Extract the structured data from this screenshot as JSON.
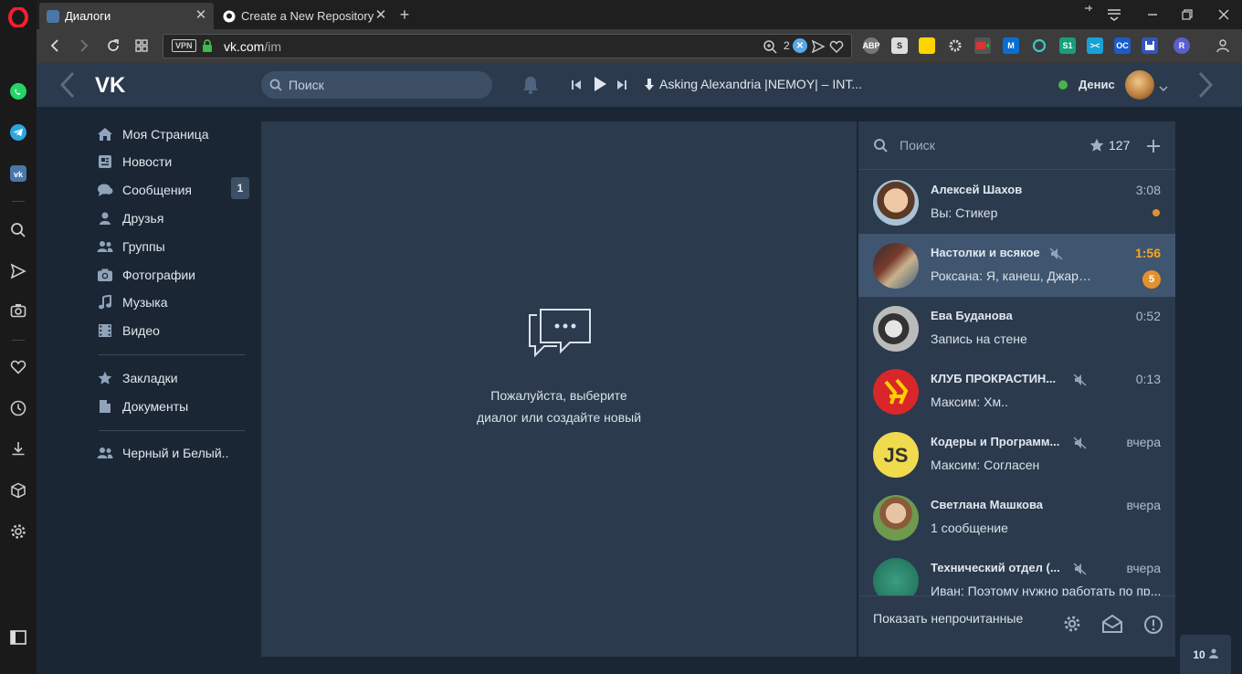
{
  "browser": {
    "tabs": [
      {
        "label": "Диалоги",
        "active": true
      },
      {
        "label": "Create a New Repository",
        "active": false
      }
    ],
    "url_host": "vk.com",
    "url_path": "/im",
    "vpn_label": "VPN",
    "zoom_badge": "2",
    "extensions": [
      "ABP",
      "S",
      "S1",
      "OC",
      "R"
    ]
  },
  "vk": {
    "search_placeholder": "Поиск",
    "now_playing": "Asking Alexandria |NEMOY| – INT...",
    "user_name": "Денис",
    "menu": [
      {
        "label": "Моя Страница",
        "icon": "home-icon"
      },
      {
        "label": "Новости",
        "icon": "news-icon"
      },
      {
        "label": "Сообщения",
        "icon": "messages-icon",
        "badge": "1"
      },
      {
        "label": "Друзья",
        "icon": "friend-icon"
      },
      {
        "label": "Группы",
        "icon": "groups-icon"
      },
      {
        "label": "Фотографии",
        "icon": "camera-icon"
      },
      {
        "label": "Музыка",
        "icon": "music-icon"
      },
      {
        "label": "Видео",
        "icon": "video-icon"
      },
      {
        "label": "Закладки",
        "icon": "star-icon"
      },
      {
        "label": "Документы",
        "icon": "document-icon"
      },
      {
        "label": "Черный и Белый..",
        "icon": "groups-icon"
      }
    ],
    "empty_line1": "Пожалуйста, выберите",
    "empty_line2": "диалог или создайте новый",
    "dialogs_search_placeholder": "Поиск",
    "favorites_count": "127",
    "conversations": [
      {
        "name": "Алексей Шахов",
        "message": "Вы: Стикер",
        "time": "3:08",
        "muted": false,
        "unread_dot": true
      },
      {
        "name": "Настолки и всякое",
        "message": "Роксана: Я, канеш, Джаре...",
        "time": "1:56",
        "muted": true,
        "unread": "5",
        "selected": true
      },
      {
        "name": "Ева Буданова",
        "message": "Запись на стене",
        "time": "0:52",
        "muted": false
      },
      {
        "name": "КЛУБ ПРОКРАСТИН...",
        "message": "Максим: Хм..",
        "time": "0:13",
        "muted": true
      },
      {
        "name": "Кодеры и Программ...",
        "message": "Максим: Согласен",
        "time": "вчера",
        "muted": true
      },
      {
        "name": "Светлана Машкова",
        "message": "1 сообщение",
        "time": "вчера",
        "muted": false
      },
      {
        "name": "Технический отдел (...",
        "message": "Иван: Поэтому нужно работать по пр...",
        "time": "вчера",
        "muted": true
      }
    ],
    "show_unread_label": "Показать непрочитанные",
    "online_count": "10"
  },
  "colors": {
    "vk_bg": "#1b2634",
    "vk_panel": "#2b3a4d",
    "accent_orange": "#e1922e",
    "opera_red": "#ff1b2d"
  }
}
